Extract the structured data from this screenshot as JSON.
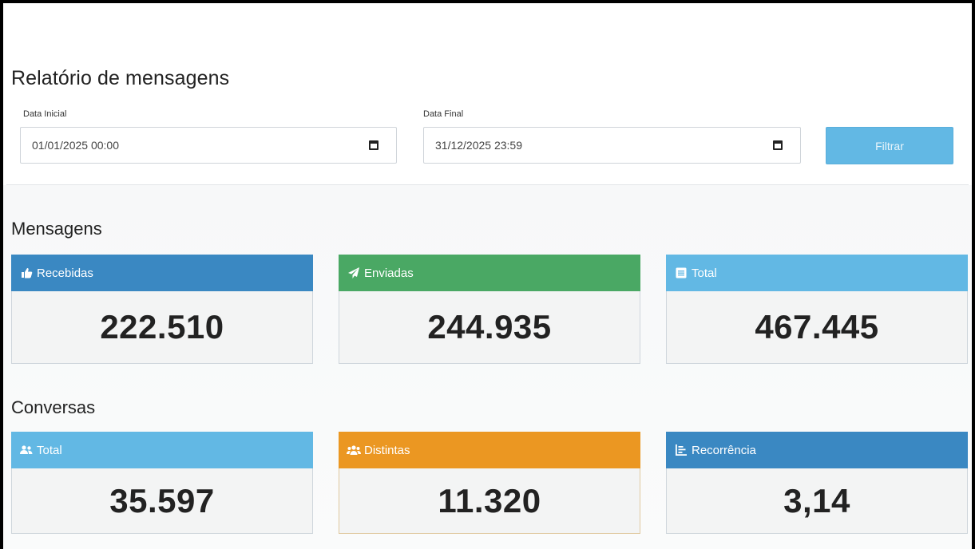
{
  "header": {
    "title": "Relatório de mensagens"
  },
  "filters": {
    "start_label": "Data Inicial",
    "start_value": "01/01/2025 00:00",
    "end_label": "Data Final",
    "end_value": "31/12/2025 23:59",
    "submit_label": "Filtrar"
  },
  "messages": {
    "section_title": "Mensagens",
    "cards": [
      {
        "label": "Recebidas",
        "value": "222.510",
        "icon": "thumbs-up-icon",
        "color": "#3a88c2"
      },
      {
        "label": "Enviadas",
        "value": "244.935",
        "icon": "paper-plane-icon",
        "color": "#4aa864"
      },
      {
        "label": "Total",
        "value": "467.445",
        "icon": "list-icon",
        "color": "#62b8e4"
      }
    ]
  },
  "conversations": {
    "section_title": "Conversas",
    "cards": [
      {
        "label": "Total",
        "value": "35.597",
        "icon": "users-icon",
        "color": "#62b8e4"
      },
      {
        "label": "Distintas",
        "value": "11.320",
        "icon": "group-icon",
        "color": "#eb9722"
      },
      {
        "label": "Recorrência",
        "value": "3,14",
        "icon": "bar-chart-icon",
        "color": "#3a88c2"
      }
    ]
  }
}
